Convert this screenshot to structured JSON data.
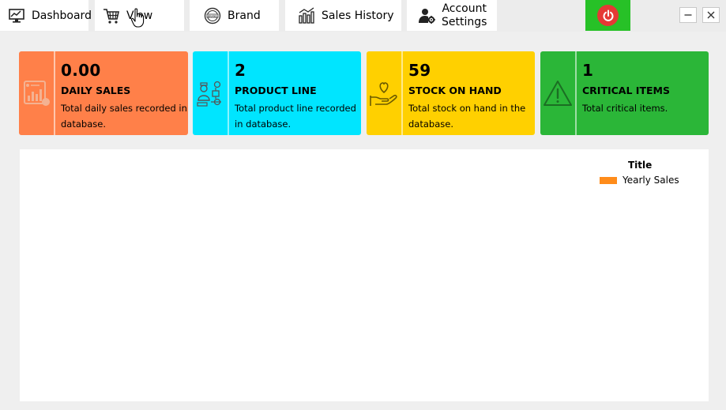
{
  "nav": {
    "tabs": [
      {
        "label": "Dashboard",
        "icon": "dashboard-icon"
      },
      {
        "label": "View",
        "icon": "cart-icon"
      },
      {
        "label": "Brand",
        "icon": "brand-icon"
      },
      {
        "label": "Sales History",
        "icon": "sales-history-icon"
      },
      {
        "label_line1": "Account",
        "label_line2": "Settings",
        "icon": "account-settings-icon"
      }
    ],
    "power_icon": "power-icon"
  },
  "window": {
    "minimize_icon": "minimize-icon",
    "close_icon": "close-icon"
  },
  "cards": [
    {
      "value": "0.00",
      "title": "DAILY SALES",
      "description": "Total daily sales recorded in database.",
      "color": "#ff8049",
      "icon": "chart-icon"
    },
    {
      "value": "2",
      "title": "PRODUCT LINE",
      "description": "Total product line recorded in database.",
      "color": "#00e5ff",
      "icon": "product-line-icon"
    },
    {
      "value": "59",
      "title": "STOCK ON HAND",
      "description": "Total stock on hand in the database.",
      "color": "#ffd000",
      "icon": "hand-heart-icon"
    },
    {
      "value": "1",
      "title": "CRITICAL ITEMS",
      "description": "Total critical items.",
      "color": "#2bb638",
      "icon": "warning-icon"
    }
  ],
  "chart": {
    "legend_title": "Title",
    "legend_items": [
      {
        "label": "Yearly Sales",
        "color": "#ff8c1a"
      }
    ]
  },
  "chart_data": {
    "type": "bar",
    "title": "",
    "categories": [],
    "series": [
      {
        "name": "Yearly Sales",
        "values": []
      }
    ],
    "legend": "top-right"
  }
}
